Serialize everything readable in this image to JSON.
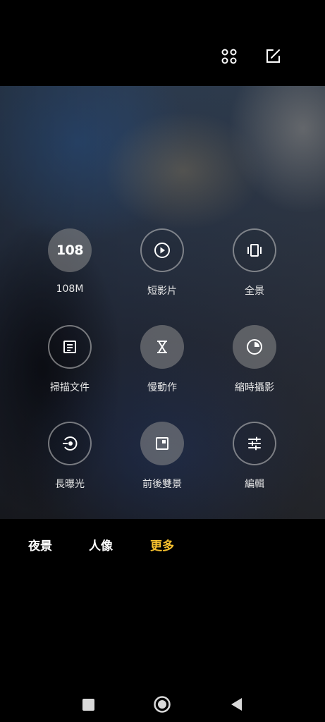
{
  "top_bar": {
    "icons": [
      "grid-icon",
      "edit-icon"
    ]
  },
  "modes": [
    {
      "id": "108m",
      "label": "108M",
      "icon_text": "108",
      "icon": "108-icon",
      "style": "filled"
    },
    {
      "id": "short-video",
      "label": "短影片",
      "icon": "play-icon",
      "style": "outline"
    },
    {
      "id": "panorama",
      "label": "全景",
      "icon": "panorama-icon",
      "style": "outline"
    },
    {
      "id": "document",
      "label": "掃描文件",
      "icon": "document-icon",
      "style": "outline"
    },
    {
      "id": "slow-motion",
      "label": "慢動作",
      "icon": "hourglass-icon",
      "style": "filled"
    },
    {
      "id": "timelapse",
      "label": "縮時攝影",
      "icon": "timer-icon",
      "style": "filled"
    },
    {
      "id": "long-exposure",
      "label": "長曝光",
      "icon": "long-exposure-icon",
      "style": "outline"
    },
    {
      "id": "dual-video",
      "label": "前後雙景",
      "icon": "dual-camera-icon",
      "style": "filled"
    },
    {
      "id": "edit",
      "label": "編輯",
      "icon": "sliders-icon",
      "style": "outline"
    }
  ],
  "mode_tabs": [
    {
      "label": "夜景",
      "active": false
    },
    {
      "label": "人像",
      "active": false
    },
    {
      "label": "更多",
      "active": true
    }
  ],
  "colors": {
    "active_tab": "#f7c02e",
    "background": "#000000"
  },
  "nav_bar": {
    "buttons": [
      "recents-icon",
      "home-icon",
      "back-icon"
    ]
  }
}
